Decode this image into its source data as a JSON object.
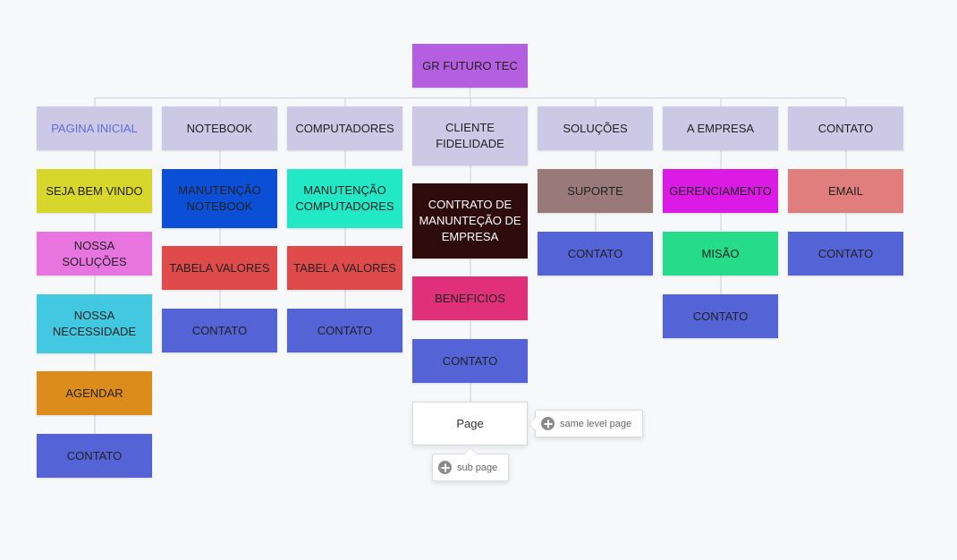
{
  "root": {
    "label": "GR FUTURO TEC",
    "color": "#b35fe0"
  },
  "columns": [
    {
      "label": "PAGINA INICIAL",
      "color": "#cdc8e6",
      "text_color": "#5b6fd6",
      "children": [
        {
          "label": "SEJA BEM VINDO",
          "color": "#d6d62c"
        },
        {
          "label": "NOSSA SOLUÇÕES",
          "color": "#e874e0"
        },
        {
          "label": "NOSSA NECESSIDADE",
          "color": "#42c8e0"
        },
        {
          "label": "AGENDAR",
          "color": "#dc8c1a"
        },
        {
          "label": "CONTATO",
          "color": "#5464d6"
        }
      ]
    },
    {
      "label": "NOTEBOOK",
      "color": "#cdc8e6",
      "children": [
        {
          "label": "MANUTENÇÃO NOTEBOOK",
          "color": "#0b4fd6"
        },
        {
          "label": "TABELA VALORES",
          "color": "#df4b4b"
        },
        {
          "label": "CONTATO",
          "color": "#5464d6"
        }
      ]
    },
    {
      "label": "COMPUTADORES",
      "color": "#cdc8e6",
      "children": [
        {
          "label": "MANUTENÇÃO COMPUTADORES",
          "color": "#22e8c6"
        },
        {
          "label": "TABEL A VALORES",
          "color": "#df4b4b"
        },
        {
          "label": "CONTATO",
          "color": "#5464d6"
        }
      ]
    },
    {
      "label": "CLIENTE FIDELIDADE",
      "color": "#cdc8e6",
      "children": [
        {
          "label": "CONTRATO DE MANUNTEÇÃO DE EMPRESA",
          "color": "#2e0c0c",
          "text_color": "#ffffff"
        },
        {
          "label": "BENEFICIOS",
          "color": "#e0307a"
        },
        {
          "label": "CONTATO",
          "color": "#5464d6"
        }
      ]
    },
    {
      "label": "SOLUÇÕES",
      "color": "#cdc8e6",
      "children": [
        {
          "label": "SUPORTE",
          "color": "#9a7a78"
        },
        {
          "label": "CONTATO",
          "color": "#5464d6"
        }
      ]
    },
    {
      "label": "A EMPRESA",
      "color": "#cdc8e6",
      "children": [
        {
          "label": "GERENCIAMENTO",
          "color": "#dc1ae6"
        },
        {
          "label": "MISÃO",
          "color": "#26dc8a"
        },
        {
          "label": "CONTATO",
          "color": "#5464d6"
        }
      ]
    },
    {
      "label": "CONTATO",
      "color": "#cdc8e6",
      "children": [
        {
          "label": "EMAIL",
          "color": "#df7e7c"
        },
        {
          "label": "CONTATO",
          "color": "#5464d6"
        }
      ]
    }
  ],
  "new_page": {
    "label": "Page"
  },
  "actions": {
    "same_level": {
      "label": "same level page",
      "icon": "plus-circle-icon"
    },
    "sub_page": {
      "label": "sub page",
      "icon": "plus-circle-icon"
    }
  },
  "line_color": "#cfcfd4"
}
